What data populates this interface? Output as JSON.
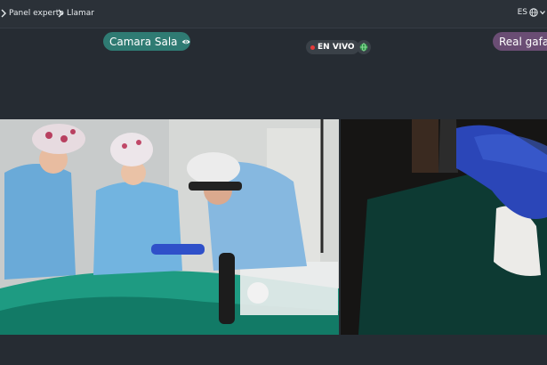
{
  "breadcrumb": {
    "items": [
      "Panel experto",
      "Llamar"
    ]
  },
  "language": {
    "code": "ES"
  },
  "streams": {
    "room_camera": {
      "label": "Camara Sala",
      "color": "#2f7b73"
    },
    "glasses_camera": {
      "label": "Real gafas",
      "color": "#6a4d74"
    }
  },
  "live_badge": {
    "label": "EN VIVO",
    "dot_color": "#e53a3a"
  },
  "icons": [
    "chevron-right-icon",
    "globe-icon",
    "chevron-down-icon",
    "eye-icon",
    "record-dot-icon"
  ]
}
